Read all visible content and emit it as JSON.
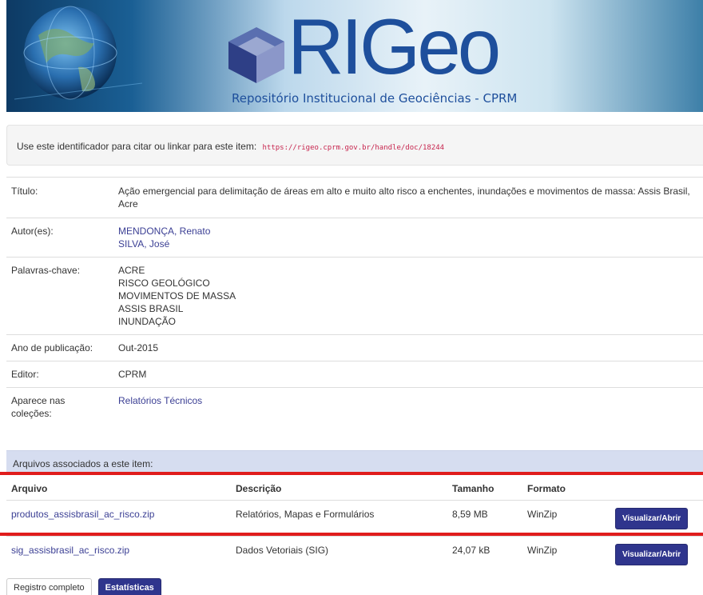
{
  "banner": {
    "logo_text": "RIGeo",
    "subtitle": "Repositório Institucional de Geociências - CPRM"
  },
  "identifier": {
    "label": "Use este identificador para citar ou linkar para este item:",
    "url": "https://rigeo.cprm.gov.br/handle/doc/18244"
  },
  "metadata": {
    "titulo_label": "Título:",
    "titulo_value": "Ação emergencial para delimitação de áreas em alto e muito alto risco a enchentes, inundações e movimentos de massa: Assis Brasil, Acre",
    "autores_label": "Autor(es):",
    "autores": [
      "MENDONÇA, Renato",
      "SILVA, José"
    ],
    "palavras_label": "Palavras-chave:",
    "palavras": [
      "ACRE",
      "RISCO GEOLÓGICO",
      "MOVIMENTOS DE MASSA",
      "ASSIS BRASIL",
      "INUNDAÇÃO"
    ],
    "ano_label": "Ano de publicação:",
    "ano_value": "Out-2015",
    "editor_label": "Editor:",
    "editor_value": "CPRM",
    "colecoes_label": "Aparece nas coleções:",
    "colecoes_value": "Relatórios Técnicos"
  },
  "files": {
    "panel_title": "Arquivos associados a este item:",
    "headers": {
      "arquivo": "Arquivo",
      "descricao": "Descrição",
      "tamanho": "Tamanho",
      "formato": "Formato"
    },
    "rows": [
      {
        "name": "produtos_assisbrasil_ac_risco.zip",
        "desc": "Relatórios, Mapas e Formulários",
        "size": "8,59 MB",
        "format": "WinZip",
        "button": "Visualizar/Abrir"
      },
      {
        "name": "sig_assisbrasil_ac_risco.zip",
        "desc": "Dados Vetoriais (SIG)",
        "size": "24,07 kB",
        "format": "WinZip",
        "button": "Visualizar/Abrir"
      }
    ]
  },
  "actions": {
    "full_record": "Registro completo",
    "stats": "Estatísticas"
  },
  "colors": {
    "link": "#3b3f94",
    "primary_button": "#2f358d",
    "panel_header": "#d6ddf0",
    "highlight_line": "#e01c1c",
    "code": "#c7254e"
  }
}
